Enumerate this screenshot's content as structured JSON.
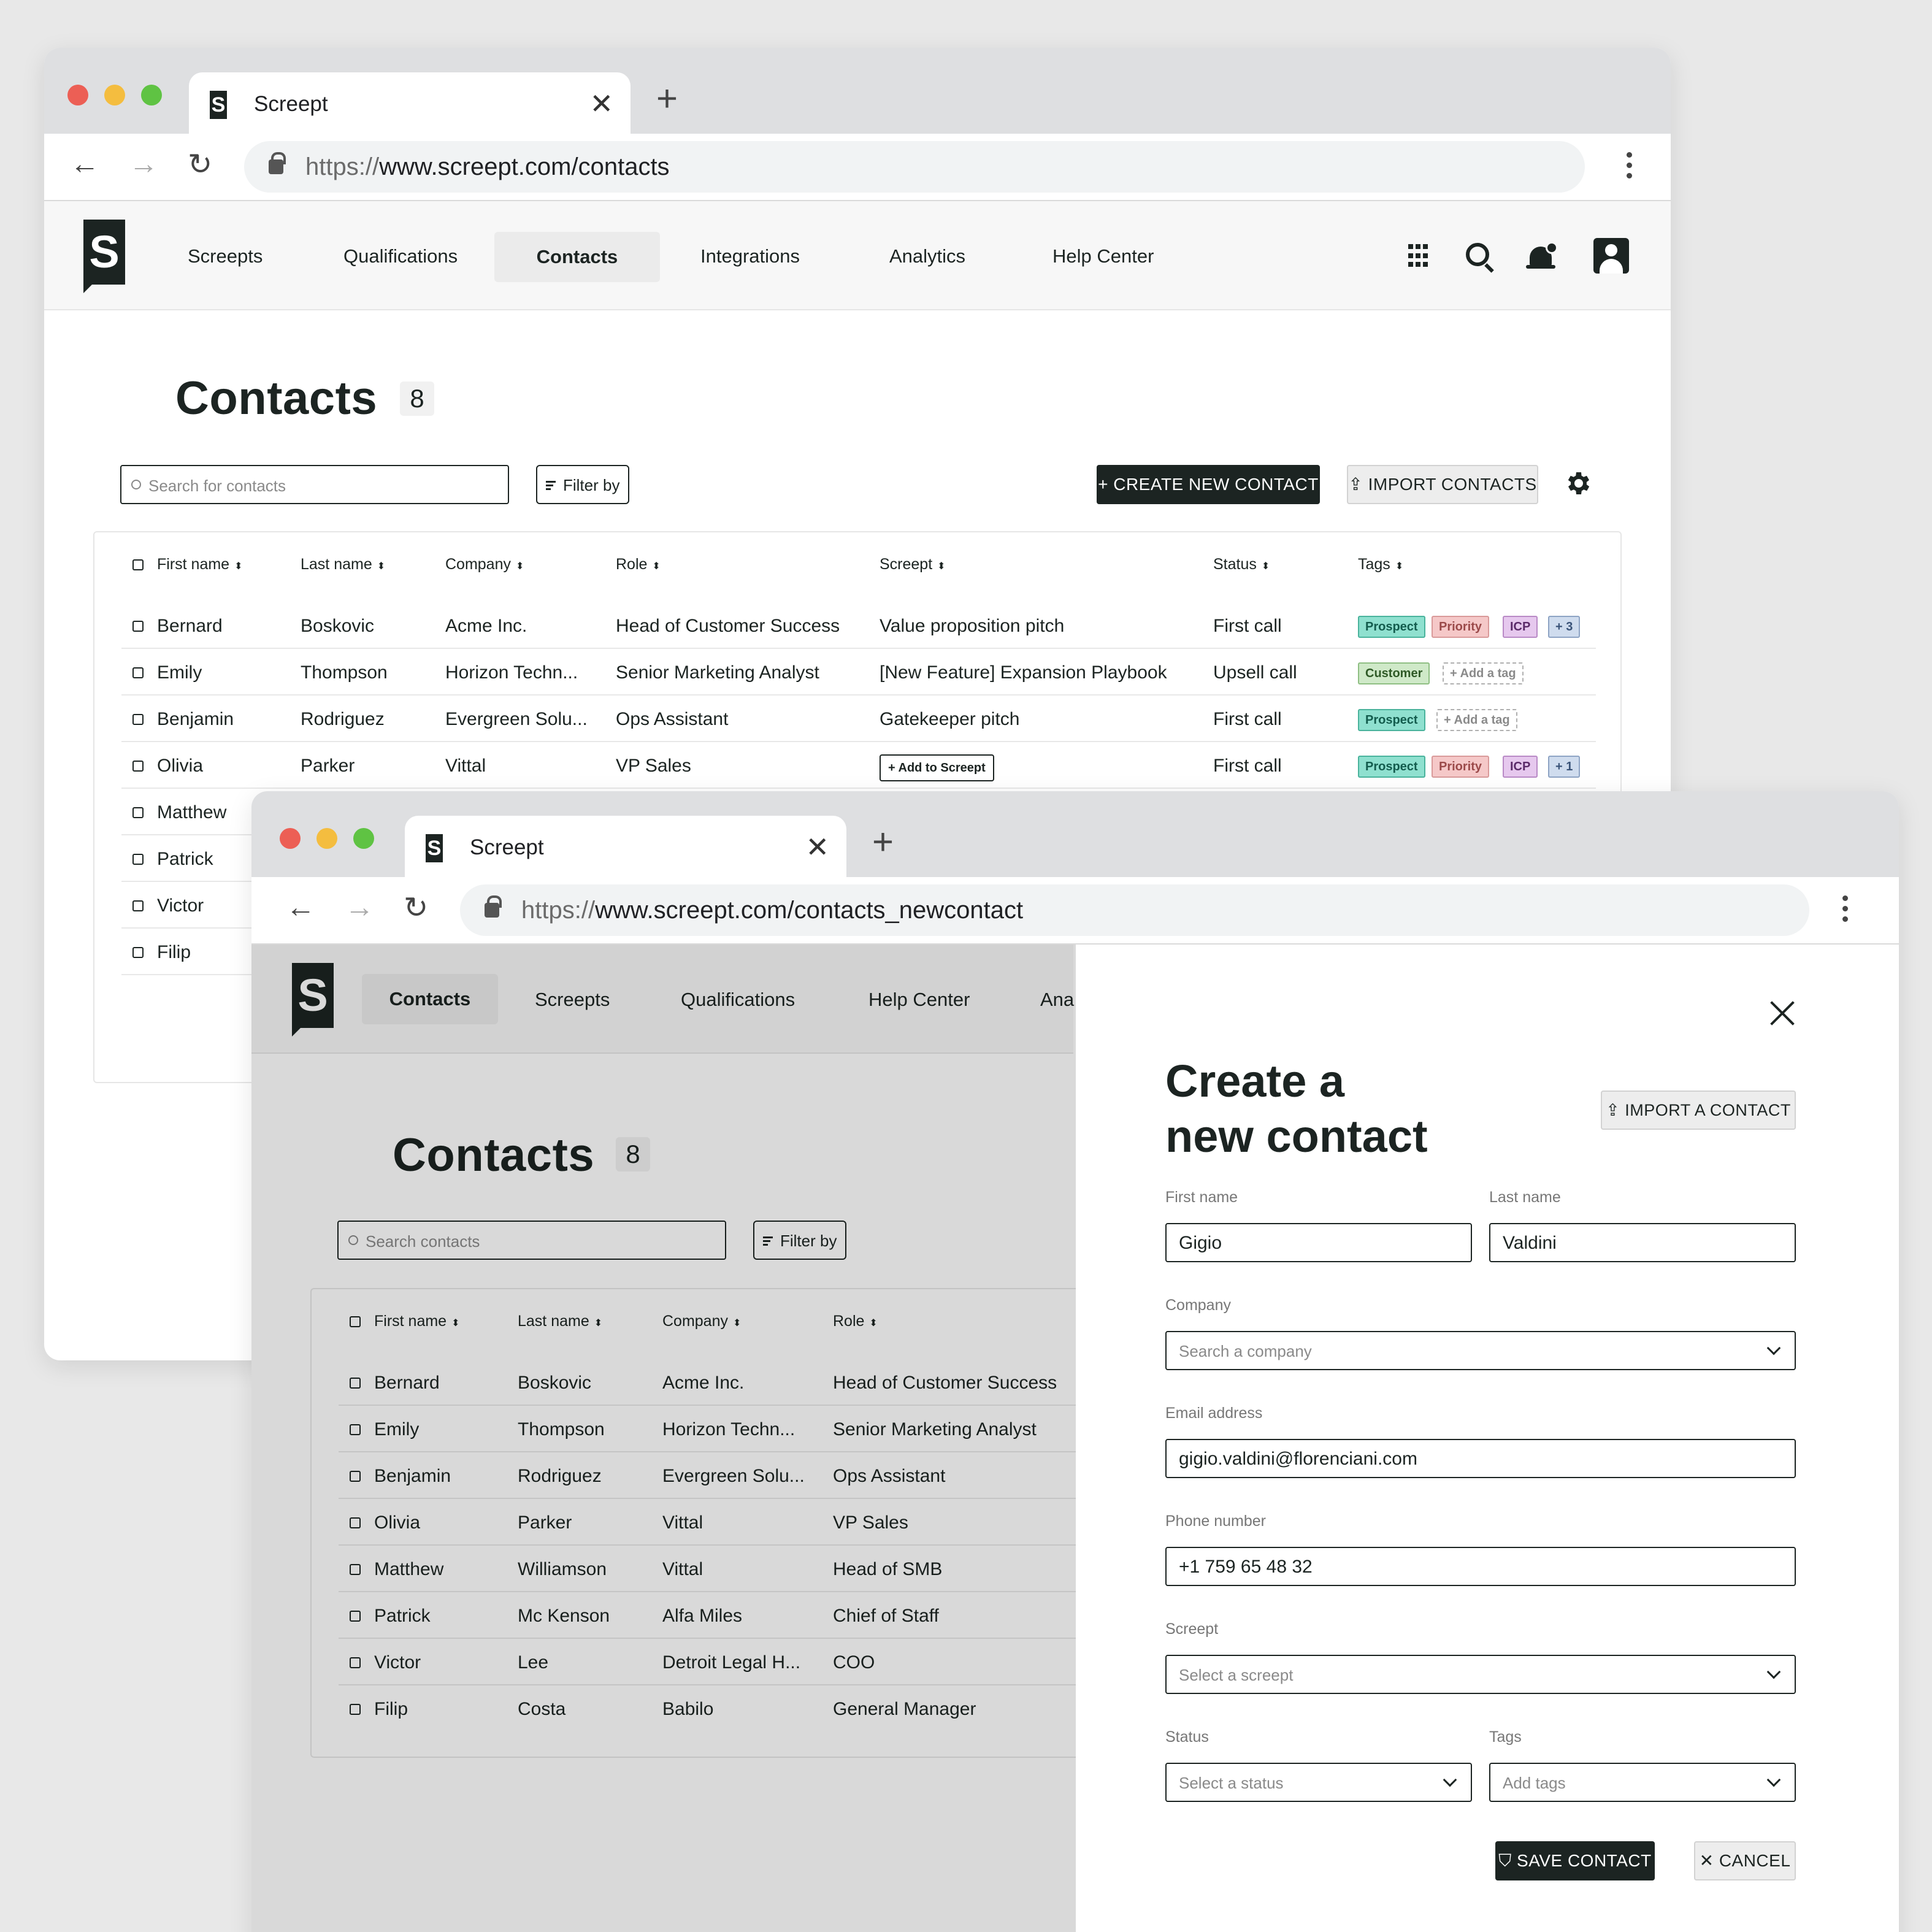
{
  "browser1": {
    "tab_title": "Screept",
    "url_scheme": "https://",
    "url_rest": "www.screept.com/contacts",
    "nav": [
      "Screepts",
      "Qualifications",
      "Contacts",
      "Integrations",
      "Analytics",
      "Help Center"
    ],
    "active_nav": "Contacts",
    "page_title": "Contacts",
    "count": "8",
    "search_placeholder": "Search for contacts",
    "filter_label": "Filter by",
    "create_label": "+ CREATE NEW CONTACT",
    "import_label": "⇪ IMPORT CONTACTS",
    "columns": [
      "First name",
      "Last name",
      "Company",
      "Role",
      "Screept",
      "Status",
      "Tags"
    ],
    "rows": [
      {
        "first": "Bernard",
        "last": "Boskovic",
        "company": "Acme Inc.",
        "role": "Head of Customer Success",
        "screept": "Value proposition pitch",
        "status": "First call",
        "tags": [
          "Prospect",
          "Priority",
          "ICP",
          "+ 3"
        ]
      },
      {
        "first": "Emily",
        "last": "Thompson",
        "company": "Horizon Techn...",
        "role": "Senior Marketing Analyst",
        "screept": "[New Feature] Expansion Playbook",
        "status": "Upsell call",
        "tags": [
          "Customer",
          "+ Add a tag"
        ]
      },
      {
        "first": "Benjamin",
        "last": "Rodriguez",
        "company": "Evergreen Solu...",
        "role": "Ops Assistant",
        "screept": "Gatekeeper pitch",
        "status": "First call",
        "tags": [
          "Prospect",
          "+ Add a tag"
        ]
      },
      {
        "first": "Olivia",
        "last": "Parker",
        "company": "Vittal",
        "role": "VP Sales",
        "screept": "+ Add to Screept",
        "status": "First call",
        "tags": [
          "Prospect",
          "Priority",
          "ICP",
          "+ 1"
        ]
      },
      {
        "first": "Matthew"
      },
      {
        "first": "Patrick"
      },
      {
        "first": "Victor"
      },
      {
        "first": "Filip"
      }
    ]
  },
  "browser2": {
    "tab_title": "Screept",
    "url_scheme": "https://",
    "url_rest": "www.screept.com/contacts_newcontact",
    "nav": [
      "Contacts",
      "Screepts",
      "Qualifications",
      "Help Center",
      "Ana"
    ],
    "page_title": "Contacts",
    "count": "8",
    "search_placeholder": "Search contacts",
    "filter_label": "Filter by",
    "columns": [
      "First name",
      "Last name",
      "Company",
      "Role"
    ],
    "rows": [
      {
        "first": "Bernard",
        "last": "Boskovic",
        "company": "Acme Inc.",
        "role": "Head of Customer Success"
      },
      {
        "first": "Emily",
        "last": "Thompson",
        "company": "Horizon Techn...",
        "role": "Senior Marketing Analyst"
      },
      {
        "first": "Benjamin",
        "last": "Rodriguez",
        "company": "Evergreen Solu...",
        "role": "Ops Assistant"
      },
      {
        "first": "Olivia",
        "last": "Parker",
        "company": "Vittal",
        "role": "VP Sales"
      },
      {
        "first": "Matthew",
        "last": "Williamson",
        "company": "Vittal",
        "role": "Head of SMB"
      },
      {
        "first": "Patrick",
        "last": "Mc Kenson",
        "company": "Alfa Miles",
        "role": "Chief of Staff"
      },
      {
        "first": "Victor",
        "last": "Lee",
        "company": "Detroit Legal H...",
        "role": "COO"
      },
      {
        "first": "Filip",
        "last": "Costa",
        "company": "Babilo",
        "role": "General Manager"
      }
    ]
  },
  "panel": {
    "title_line1": "Create a",
    "title_line2": "new contact",
    "import_label": "⇪ IMPORT A CONTACT",
    "first_name_label": "First name",
    "first_name_value": "Gigio",
    "last_name_label": "Last name",
    "last_name_value": "Valdini",
    "company_label": "Company",
    "company_placeholder": "Search a company",
    "email_label": "Email address",
    "email_value": "gigio.valdini@florenciani.com",
    "phone_label": "Phone number",
    "phone_value": "+1 759 65 48 32",
    "screept_label": "Screept",
    "screept_placeholder": "Select a screept",
    "status_label": "Status",
    "status_placeholder": "Select a status",
    "tags_label": "Tags",
    "tags_placeholder": "Add tags",
    "save_label": "⛉ SAVE CONTACT",
    "cancel_label": "✕ CANCEL"
  },
  "colors": {
    "brand_dark": "#1c2422",
    "tag_prospect": "#8fe0cf",
    "tag_priority": "#f5c8c8",
    "tag_icp": "#e6c8ee",
    "tag_more": "#cfdcee",
    "tag_customer": "#cfe9c8"
  }
}
